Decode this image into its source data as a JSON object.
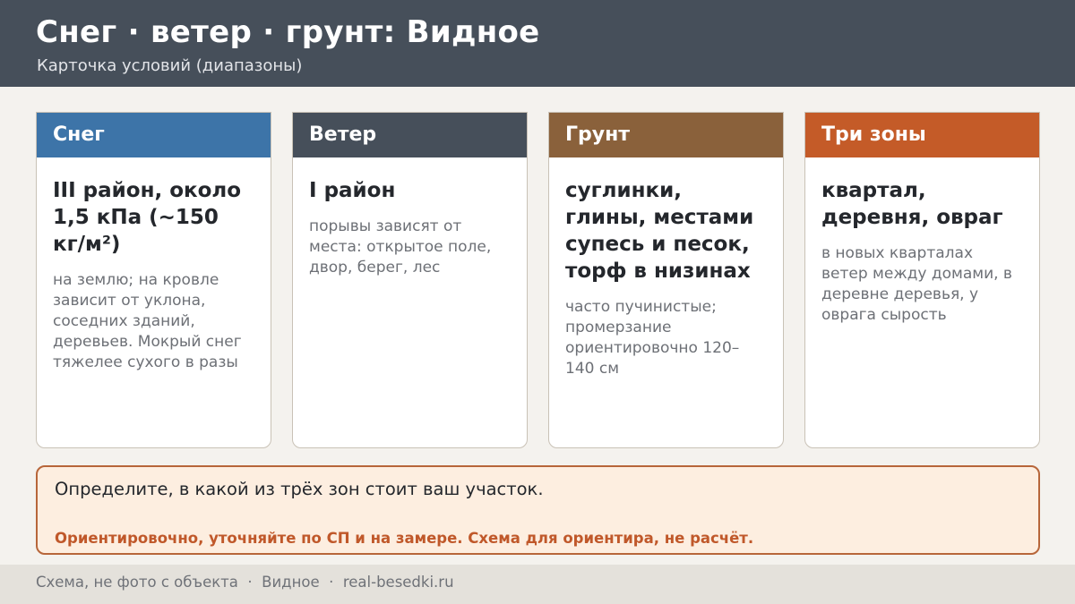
{
  "header": {
    "title": "Снег · ветер · грунт: Видное",
    "subtitle": "Карточка условий (диапазоны)"
  },
  "cards": [
    {
      "heading": "Снег",
      "color": "#3d74a8",
      "main": "III район, около 1,5 кПа (~150 кг/м²)",
      "note": "на землю; на кровле зависит от уклона, соседних зданий, деревьев. Мокрый снег тяжелее сухого в разы"
    },
    {
      "heading": "Ветер",
      "color": "#464f5a",
      "main": "I район",
      "note": "порывы зависят от места: открытое поле, двор, берег, лес"
    },
    {
      "heading": "Грунт",
      "color": "#8a613b",
      "main": "суглинки, глины, местами супесь и песок, торф в низинах",
      "note": "часто пучинистые; промерзание ориентировочно 120–140 см"
    },
    {
      "heading": "Три зоны",
      "color": "#c45b28",
      "main": "квартал, деревня, овраг",
      "note": "в новых кварталах ветер между домами, в деревне деревья, у оврага сырость"
    }
  ],
  "callout": {
    "text": "Определите, в какой из трёх зон стоит ваш участок.",
    "warning": "Ориентировочно, уточняйте по СП и на замере. Схема для ориентира, не расчёт."
  },
  "footer": {
    "text": "Схема, не фото с объекта  ·  Видное  ·  real-besedki.ru"
  }
}
